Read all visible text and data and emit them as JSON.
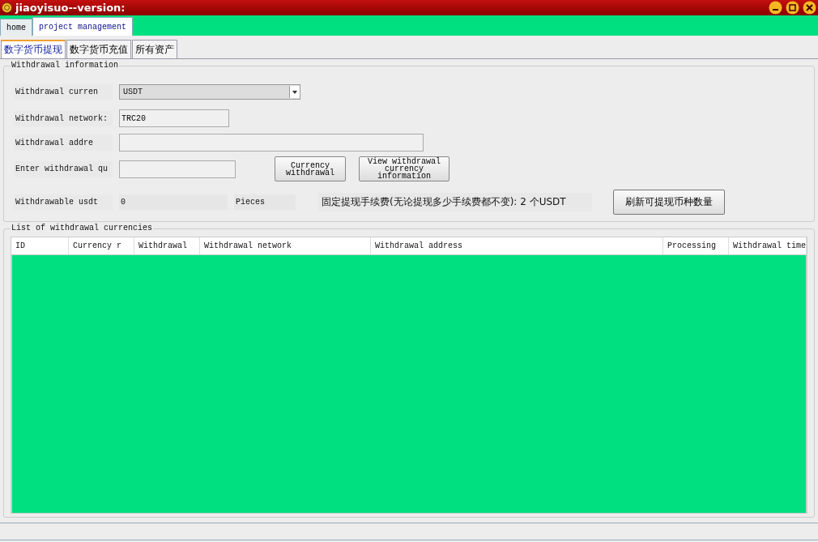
{
  "window": {
    "title": "jiaoyisuo--version:"
  },
  "main_tabs": [
    {
      "label": "home",
      "selected": false
    },
    {
      "label": "project management",
      "selected": true
    }
  ],
  "sub_tabs": [
    {
      "label": "数字货币提现",
      "selected": true
    },
    {
      "label": "数字货币充值",
      "selected": false
    },
    {
      "label": "所有资产",
      "selected": false
    }
  ],
  "withdrawal_info": {
    "title": "Withdrawal information",
    "currency": {
      "label": "Withdrawal curren",
      "value": "USDT"
    },
    "network": {
      "label": "Withdrawal network:",
      "value": "TRC20"
    },
    "address": {
      "label": "Withdrawal addre"
    },
    "quantity": {
      "label": "Enter withdrawal qu"
    },
    "buttons": [
      "Currency withdrawal",
      "View withdrawal currency information"
    ],
    "withdrawable": {
      "label": "Withdrawable usdt",
      "value": "0",
      "unit": "Pieces"
    },
    "fee_note": "固定提现手续费(无论提现多少手续费都不变): 2 个USDT",
    "refresh_button": "刷新可提现币种数量"
  },
  "withdrawal_list": {
    "title": "List of withdrawal currencies",
    "columns": [
      "ID",
      "Currency r",
      "Withdrawal",
      "Withdrawal network",
      "Withdrawal address",
      "Processing",
      "Withdrawal time"
    ]
  }
}
